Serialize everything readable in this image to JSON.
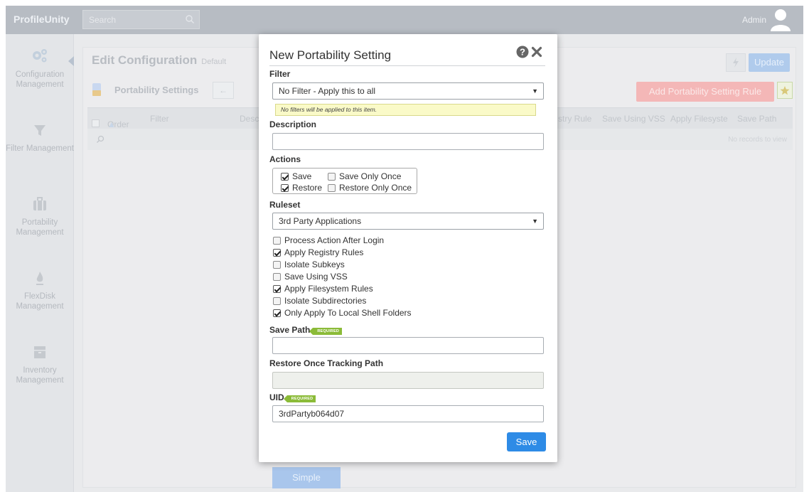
{
  "app": {
    "brand": "ProfileUnity",
    "search_placeholder": "Search",
    "user_name": "Admin"
  },
  "sidebar": {
    "items": [
      {
        "label": "Configuration Management",
        "icon": "gears-icon"
      },
      {
        "label": "Filter Management",
        "icon": "funnel-icon"
      },
      {
        "label": "Portability Management",
        "icon": "briefcase-icon"
      },
      {
        "label": "FlexDisk Management",
        "icon": "flame-icon"
      },
      {
        "label": "Inventory Management",
        "icon": "archive-box-icon"
      }
    ]
  },
  "main": {
    "title": "Edit Configuration",
    "subtitle": "Default",
    "update_label": "Update",
    "section_title": "Portability Settings",
    "add_rule_label": "Add Portability Setting Rule",
    "grid_columns_left": [
      "Order",
      "Filter",
      "Desc"
    ],
    "grid_columns_right": [
      "stry Rule",
      "Save Using VSS",
      "Apply Filesyste",
      "Save Path"
    ],
    "no_records": "No records to view",
    "simple_label": "Simple"
  },
  "modal": {
    "title": "New Portability Setting",
    "filter_label": "Filter",
    "filter_value": "No Filter - Apply this to all",
    "filter_hint": "No filters will be applied to this item.",
    "description_label": "Description",
    "description_value": "",
    "actions_label": "Actions",
    "actions": {
      "save": {
        "label": "Save",
        "checked": true
      },
      "save_once": {
        "label": "Save Only Once",
        "checked": false
      },
      "restore": {
        "label": "Restore",
        "checked": true
      },
      "restore_once": {
        "label": "Restore Only Once",
        "checked": false
      }
    },
    "ruleset_label": "Ruleset",
    "ruleset_value": "3rd Party Applications",
    "options": [
      {
        "label": "Process Action After Login",
        "checked": false
      },
      {
        "label": "Apply Registry Rules",
        "checked": true
      },
      {
        "label": "Isolate Subkeys",
        "checked": false
      },
      {
        "label": "Save Using VSS",
        "checked": false
      },
      {
        "label": "Apply Filesystem Rules",
        "checked": true
      },
      {
        "label": "Isolate Subdirectories",
        "checked": false
      },
      {
        "label": "Only Apply To Local Shell Folders",
        "checked": true
      }
    ],
    "save_path_label": "Save Path",
    "save_path_value": "",
    "required_badge": "REQUIRED",
    "restore_tracking_label": "Restore Once Tracking Path",
    "restore_tracking_value": "",
    "uid_label": "UID",
    "uid_value": "3rdPartyb064d07",
    "save_button": "Save"
  }
}
